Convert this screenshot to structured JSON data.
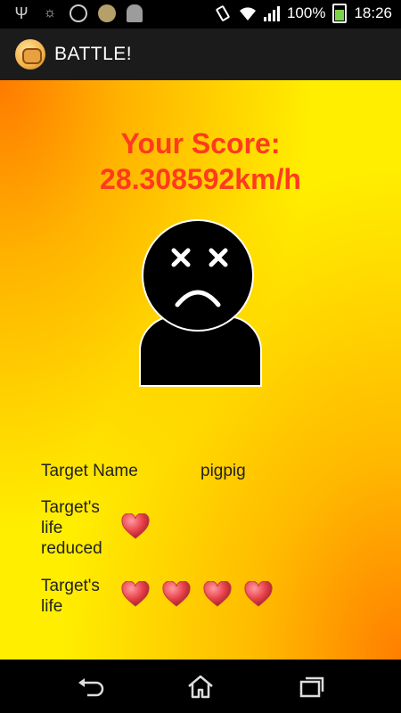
{
  "status_bar": {
    "icons_left": [
      "usb-icon",
      "lightbulb-icon",
      "whatsapp-icon",
      "coin-app-icon",
      "android-icon"
    ],
    "battery_percent": "100%",
    "time": "18:26"
  },
  "action_bar": {
    "title": "BATTLE!"
  },
  "score": {
    "label": "Your Score:",
    "value": "28.308592km/h"
  },
  "target": {
    "name_label": "Target Name",
    "name_value": "pigpig",
    "life_reduced_label_line1": "Target's",
    "life_reduced_label_line2": "life",
    "life_reduced_label_line3": "reduced",
    "life_reduced_hearts": 1,
    "life_label_line1": "Target's",
    "life_label_line2": "life",
    "life_hearts": 4
  },
  "colors": {
    "score_text": "#ff3a1e",
    "background_center": "#ffee00",
    "background_edges": "#ff8000",
    "heart": "#e8414a"
  }
}
